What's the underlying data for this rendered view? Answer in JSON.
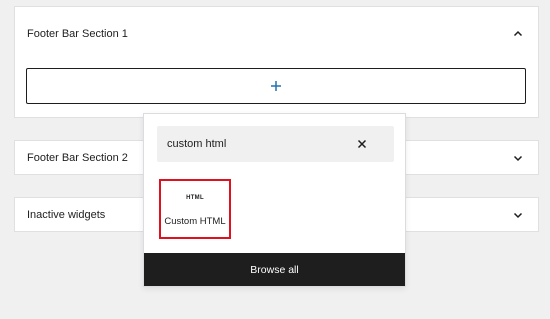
{
  "sections": [
    {
      "title": "Footer Bar Section 1",
      "expanded": true
    },
    {
      "title": "Footer Bar Section 2",
      "expanded": false
    },
    {
      "title": "Inactive widgets",
      "expanded": false
    }
  ],
  "add_block": {
    "icon": "plus-icon",
    "color": "#2271b1"
  },
  "inserter": {
    "search_value": "custom html",
    "clear_icon": "close-icon",
    "results": [
      {
        "icon_text": "HTML",
        "label": "Custom HTML",
        "highlight_color": "#e0101e"
      }
    ],
    "browse_all_label": "Browse all"
  }
}
